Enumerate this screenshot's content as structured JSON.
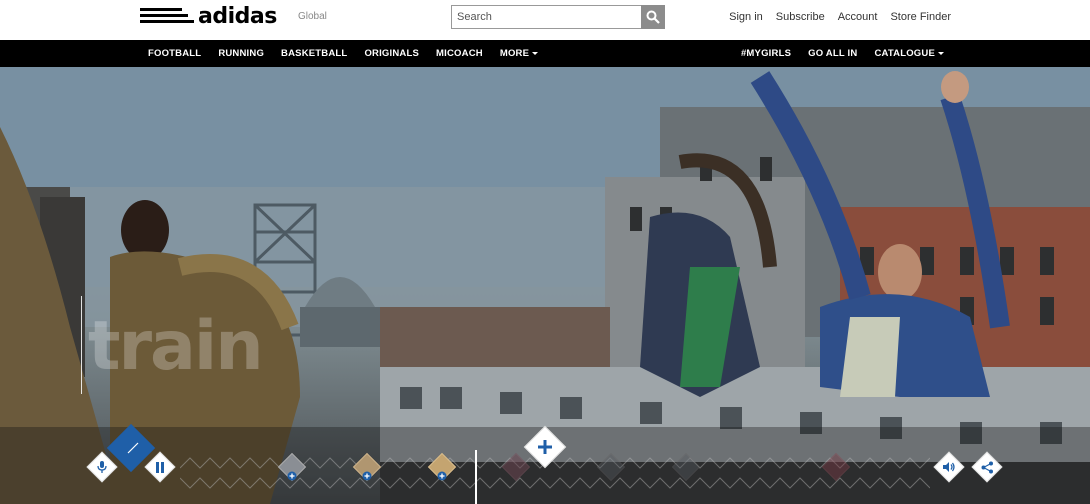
{
  "header": {
    "brand": "adidas",
    "region": "Global",
    "search_placeholder": "Search",
    "links": [
      "Sign in",
      "Subscribe",
      "Account",
      "Store Finder"
    ]
  },
  "nav": {
    "left": [
      {
        "label": "FOOTBALL",
        "dropdown": false
      },
      {
        "label": "RUNNING",
        "dropdown": false
      },
      {
        "label": "BASKETBALL",
        "dropdown": false
      },
      {
        "label": "ORIGINALS",
        "dropdown": false
      },
      {
        "label": "MICOACH",
        "dropdown": false
      },
      {
        "label": "MORE",
        "dropdown": true
      }
    ],
    "right": [
      {
        "label": "#MYGIRLS",
        "dropdown": false
      },
      {
        "label": "GO ALL IN",
        "dropdown": false
      },
      {
        "label": "CATALOGUE",
        "dropdown": true
      }
    ]
  },
  "hero": {
    "word": "train"
  },
  "player": {
    "accent_color": "#1f5fa8",
    "icons": [
      "microphone-icon",
      "pause-icon",
      "volume-icon",
      "share-icon",
      "plus-icon"
    ]
  }
}
